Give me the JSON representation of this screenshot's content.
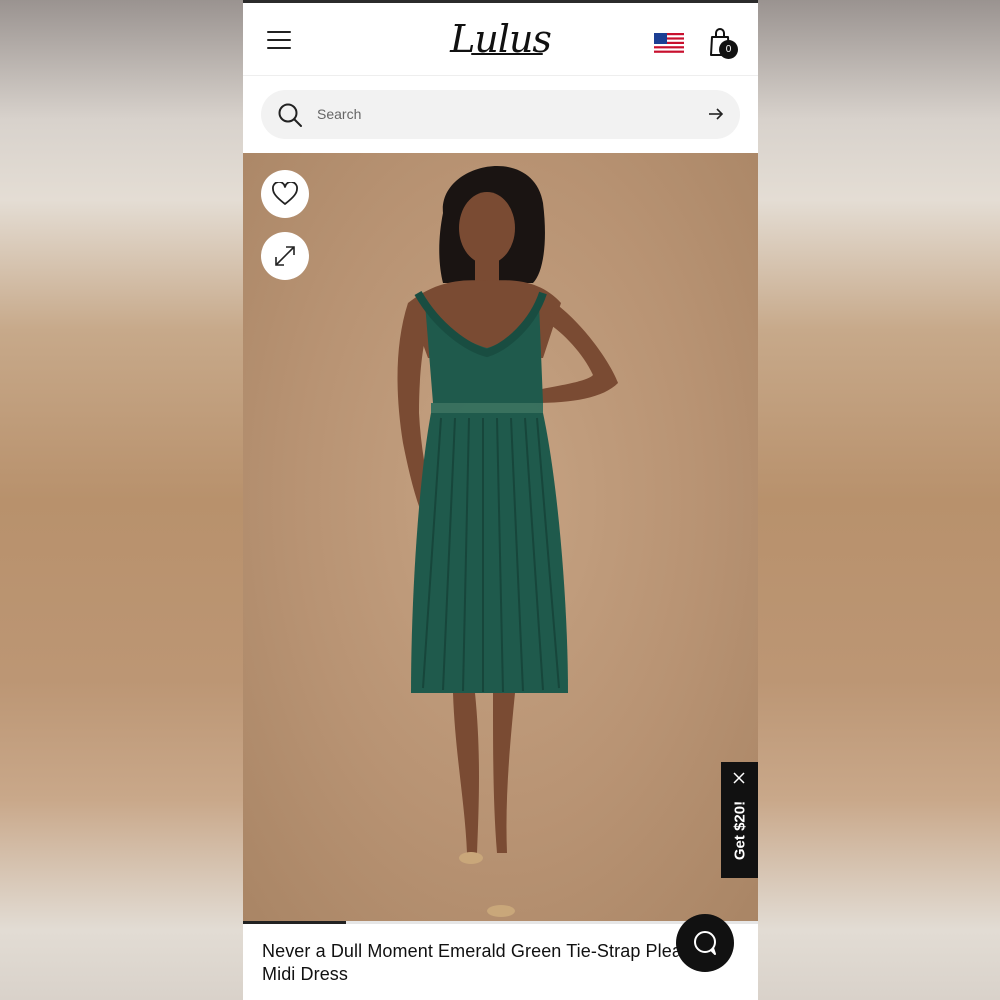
{
  "header": {
    "logo": "Lulus",
    "cart_count": "0"
  },
  "search": {
    "placeholder": "Search"
  },
  "product": {
    "title": "Never a Dull Moment Emerald Green Tie-Strap Pleated Midi Dress",
    "gallery_progress": 0.2,
    "dress_color": "#1f5a4c"
  },
  "promo": {
    "label": "Get $20!"
  }
}
